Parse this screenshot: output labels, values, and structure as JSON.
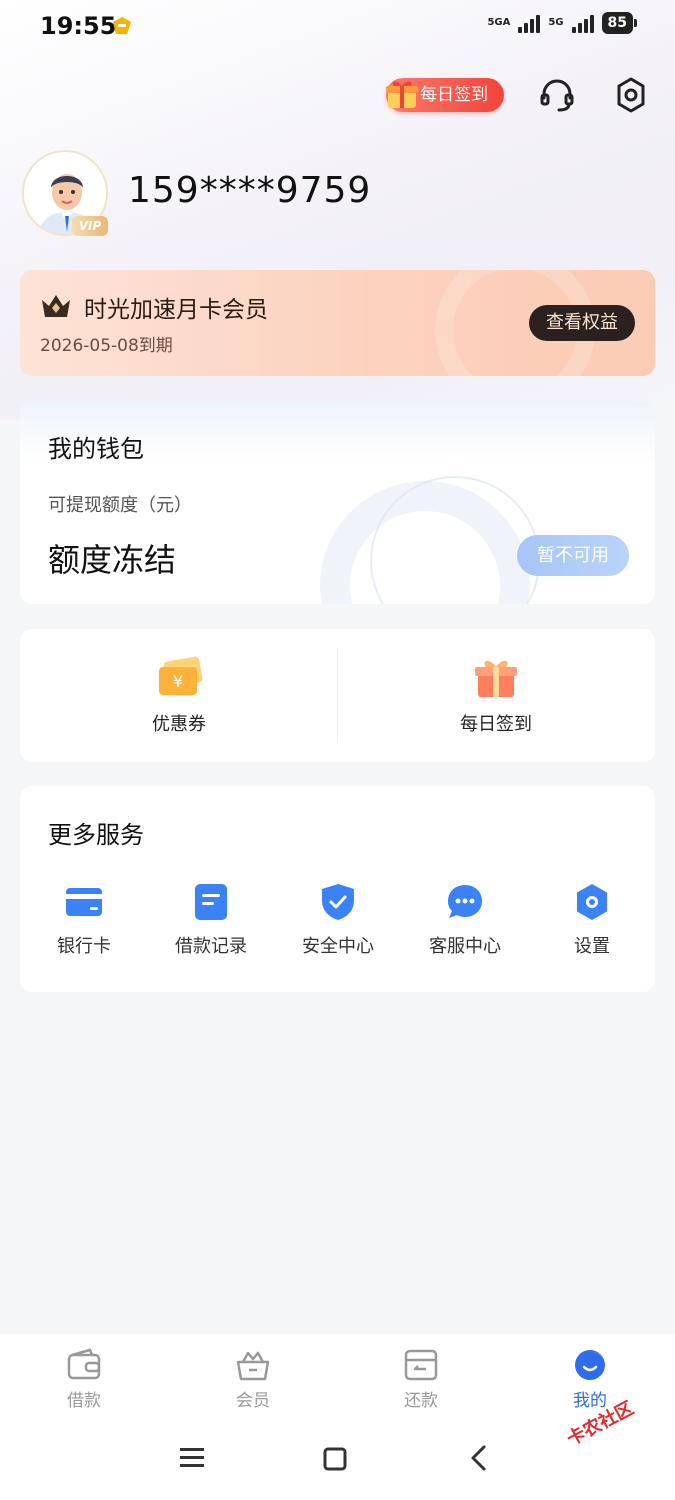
{
  "status_bar": {
    "time": "19:55",
    "network_1": "5GA",
    "network_2": "5G",
    "battery": "85"
  },
  "header": {
    "daily_checkin_label": "每日签到"
  },
  "profile": {
    "phone": "159****9759",
    "vip_label": "VIP"
  },
  "membership": {
    "title": "时光加速月卡会员",
    "expire": "2026-05-08到期",
    "button": "查看权益"
  },
  "wallet": {
    "title": "我的钱包",
    "subtitle": "可提现额度（元）",
    "value": "额度冻结",
    "button": "暂不可用"
  },
  "quick_actions": [
    {
      "label": "优惠券",
      "icon": "coupon-icon"
    },
    {
      "label": "每日签到",
      "icon": "gift-icon"
    }
  ],
  "services": {
    "title": "更多服务",
    "items": [
      {
        "label": "银行卡",
        "icon": "bank-card-icon"
      },
      {
        "label": "借款记录",
        "icon": "document-icon"
      },
      {
        "label": "安全中心",
        "icon": "shield-icon"
      },
      {
        "label": "客服中心",
        "icon": "chat-icon"
      },
      {
        "label": "设置",
        "icon": "gear-icon"
      }
    ]
  },
  "bottom_nav": [
    {
      "label": "借款",
      "icon": "wallet-icon",
      "active": false
    },
    {
      "label": "会员",
      "icon": "crown-basket-icon",
      "active": false
    },
    {
      "label": "还款",
      "icon": "repay-icon",
      "active": false
    },
    {
      "label": "我的",
      "icon": "profile-icon",
      "active": true
    }
  ],
  "watermark": "卡农社区",
  "colors": {
    "accent": "#2f6bea",
    "primary_icon": "#3b82f6",
    "member_dark": "#2b2220",
    "daily_red": "#f2433c"
  }
}
